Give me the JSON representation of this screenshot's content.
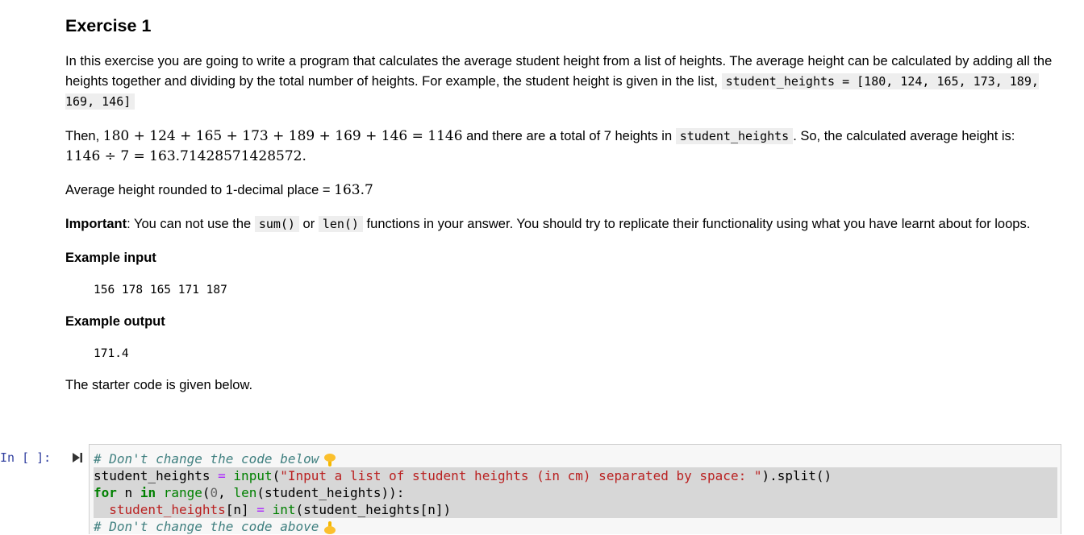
{
  "exercise": {
    "title": "Exercise 1",
    "intro_text": "In this exercise you are going to write a program that calculates the average student height from a list of heights. The average height can be calculated by adding all the heights together and dividing by the total number of heights. For example, the student height is given in the list, ",
    "intro_code": "student_heights = [180, 124, 165, 173, 189, 169, 146]",
    "then_prefix": "Then, ",
    "then_math": "180 + 124 + 165 + 173 + 189 + 169 + 146 = 1146",
    "then_mid": " and there are a total of 7 heights in ",
    "then_code": "student_heights",
    "then_suffix": ". So, the calculated average height is:",
    "calc_math": "1146 ÷ 7 = 163.71428571428572.",
    "avg_text": "Average height rounded to 1-decimal place = ",
    "avg_math": "163.7",
    "important_label": "Important",
    "important_text_1": ": You can not use the ",
    "important_code_1": "sum()",
    "important_text_2": " or ",
    "important_code_2": "len()",
    "important_text_3": " functions in your answer. You should try to replicate their functionality using what you have learnt about for loops.",
    "example_input_heading": "Example input",
    "example_input_value": "156 178 165 171 187",
    "example_output_heading": "Example output",
    "example_output_value": "171.4",
    "starter_text": "The starter code is given below."
  },
  "cell": {
    "prompt": "In [ ]:",
    "code": {
      "comment_top": "# Don't change the code below",
      "l2_var": "student_heights",
      "l2_eq": "=",
      "l2_fn": "input",
      "l2_str": "\"Input a list of student heights (in cm) separated by space: \"",
      "l2_tail": ").split()",
      "l3_for": "for",
      "l3_n": " n ",
      "l3_in": "in",
      "l3_range": "range",
      "l3_num": "0",
      "l3_len": "len",
      "l3_tail": "(student_heights)):",
      "l4_var": "student_heights",
      "l4_idx": "[n] ",
      "l4_eq": "=",
      "l4_int": "int",
      "l4_tail": "(student_heights[n])",
      "comment_bottom": "# Don't change the code above"
    }
  },
  "icons": {
    "run": "run-cell-icon",
    "point_down": "backhand-index-pointing-down-icon",
    "point_up": "backhand-index-pointing-up-icon"
  },
  "colors": {
    "prompt": "#303f9f",
    "comment": "#408080",
    "keyword": "#008000",
    "string": "#ba2121",
    "operator": "#aa22ff",
    "highlight": "#d7d7d7",
    "editor_bg": "#f7f7f7"
  }
}
